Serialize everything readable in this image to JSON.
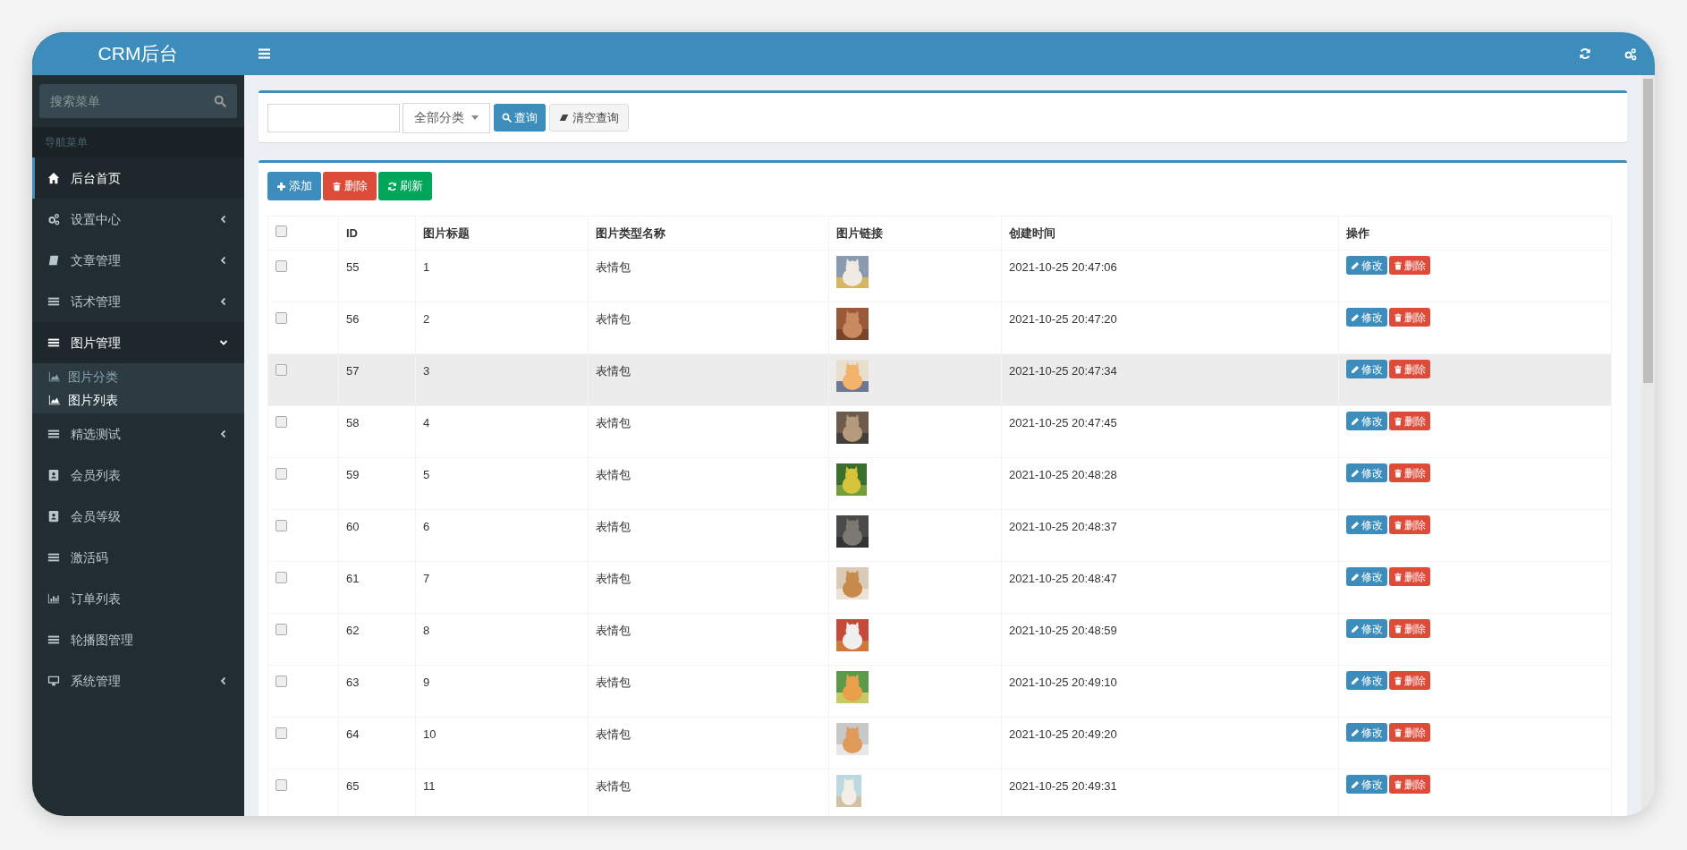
{
  "app": {
    "title": "CRM后台"
  },
  "sidebar": {
    "search": {
      "placeholder": "搜索菜单"
    },
    "section_label": "导航菜单",
    "items": [
      {
        "label": "后台首页",
        "kind": "link",
        "selected": true
      },
      {
        "label": "设置中心",
        "kind": "group",
        "expanded": false,
        "selected": false
      },
      {
        "label": "文章管理",
        "kind": "group",
        "expanded": false,
        "selected": false
      },
      {
        "label": "话术管理",
        "kind": "group",
        "expanded": false,
        "selected": false
      },
      {
        "label": "图片管理",
        "kind": "group",
        "expanded": true,
        "selected": false,
        "children": [
          {
            "label": "图片分类",
            "selected": false
          },
          {
            "label": "图片列表",
            "selected": true
          }
        ]
      },
      {
        "label": "精选测试",
        "kind": "group",
        "expanded": false,
        "selected": false
      },
      {
        "label": "会员列表",
        "kind": "link",
        "selected": false
      },
      {
        "label": "会员等级",
        "kind": "link",
        "selected": false
      },
      {
        "label": "激活码",
        "kind": "link",
        "selected": false
      },
      {
        "label": "订单列表",
        "kind": "link",
        "selected": false
      },
      {
        "label": "轮播图管理",
        "kind": "link",
        "selected": false
      },
      {
        "label": "系统管理",
        "kind": "group",
        "expanded": false,
        "selected": false
      }
    ]
  },
  "search_bar": {
    "category": "全部分类",
    "query_button": "查询",
    "clear_button": "清空查询"
  },
  "toolbar": [
    "添加",
    "删除",
    "刷新"
  ],
  "table": {
    "select_all": {
      "checked": false
    },
    "columns": [
      "ID",
      "图片标题",
      "图片类型名称",
      "图片链接",
      "创建时间",
      "操作"
    ],
    "rows": [
      {
        "checked": false,
        "hovered": false,
        "id": "55",
        "title": "1",
        "type": "表情包",
        "image": {
          "kind": "picture"
        },
        "created": "2021-10-25 20:47:06",
        "actions": [
          "修改",
          "删除"
        ]
      },
      {
        "checked": false,
        "hovered": false,
        "id": "56",
        "title": "2",
        "type": "表情包",
        "image": {
          "kind": "picture"
        },
        "created": "2021-10-25 20:47:20",
        "actions": [
          "修改",
          "删除"
        ]
      },
      {
        "checked": false,
        "hovered": true,
        "id": "57",
        "title": "3",
        "type": "表情包",
        "image": {
          "kind": "picture"
        },
        "created": "2021-10-25 20:47:34",
        "actions": [
          "修改",
          "删除"
        ]
      },
      {
        "checked": false,
        "hovered": false,
        "id": "58",
        "title": "4",
        "type": "表情包",
        "image": {
          "kind": "picture"
        },
        "created": "2021-10-25 20:47:45",
        "actions": [
          "修改",
          "删除"
        ]
      },
      {
        "checked": false,
        "hovered": false,
        "id": "59",
        "title": "5",
        "type": "表情包",
        "image": {
          "kind": "picture"
        },
        "created": "2021-10-25 20:48:28",
        "actions": [
          "修改",
          "删除"
        ]
      },
      {
        "checked": false,
        "hovered": false,
        "id": "60",
        "title": "6",
        "type": "表情包",
        "image": {
          "kind": "picture"
        },
        "created": "2021-10-25 20:48:37",
        "actions": [
          "修改",
          "删除"
        ]
      },
      {
        "checked": false,
        "hovered": false,
        "id": "61",
        "title": "7",
        "type": "表情包",
        "image": {
          "kind": "picture"
        },
        "created": "2021-10-25 20:48:47",
        "actions": [
          "修改",
          "删除"
        ]
      },
      {
        "checked": false,
        "hovered": false,
        "id": "62",
        "title": "8",
        "type": "表情包",
        "image": {
          "kind": "picture"
        },
        "created": "2021-10-25 20:48:59",
        "actions": [
          "修改",
          "删除"
        ]
      },
      {
        "checked": false,
        "hovered": false,
        "id": "63",
        "title": "9",
        "type": "表情包",
        "image": {
          "kind": "picture"
        },
        "created": "2021-10-25 20:49:10",
        "actions": [
          "修改",
          "删除"
        ]
      },
      {
        "checked": false,
        "hovered": false,
        "id": "64",
        "title": "10",
        "type": "表情包",
        "image": {
          "kind": "picture"
        },
        "created": "2021-10-25 20:49:20",
        "actions": [
          "修改",
          "删除"
        ]
      },
      {
        "checked": false,
        "hovered": false,
        "id": "65",
        "title": "11",
        "type": "表情包",
        "image": {
          "kind": "picture"
        },
        "created": "2021-10-25 20:49:31",
        "actions": [
          "修改",
          "删除"
        ]
      }
    ]
  }
}
